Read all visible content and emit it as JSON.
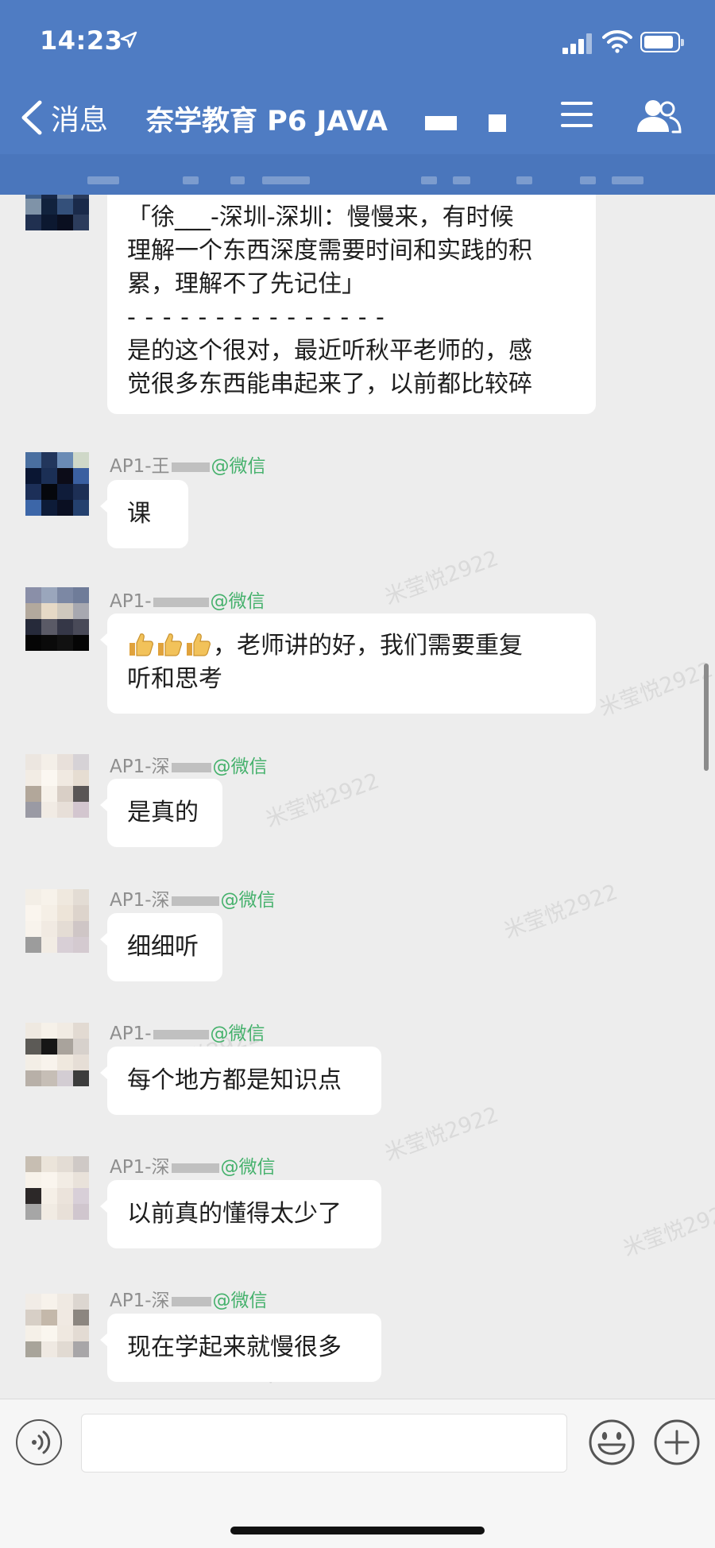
{
  "status_bar": {
    "time": "14:23",
    "icons": [
      "location-arrow-icon",
      "signal-icon",
      "wifi-icon",
      "battery-icon"
    ]
  },
  "nav": {
    "back_label": "消息",
    "title": "奈学教育 P6 JAVA",
    "icons": [
      "chevron-left-icon",
      "menu-icon",
      "people-icon"
    ]
  },
  "colors": {
    "header": "#4F7CC3",
    "chat_bg": "#EDEDED",
    "bubble": "#FFFFFF",
    "source_green": "#45B16C"
  },
  "watermark": "米莹悦2922",
  "messages": [
    {
      "lines": [
        "「徐___-深圳-深圳：慢慢来，有时候",
        "理解一个东西深度需要时间和实践的积",
        "累，理解不了先记住」",
        "- - - - - - - - - - - - - - -",
        "是的这个很对，最近听秋平老师的，感",
        "觉很多东西能串起来了，以前都比较碎"
      ]
    },
    {
      "sender_prefix": "AP1-王",
      "sender_suffix": "@微信",
      "lines": [
        "课"
      ]
    },
    {
      "sender_prefix": "AP1-",
      "sender_suffix": "@微信",
      "lines": [
        "，老师讲的好，我们需要重复",
        "听和思考"
      ],
      "emoji": "thumbs-up-icon"
    },
    {
      "sender_prefix": "AP1-深",
      "sender_suffix": "@微信",
      "lines": [
        "是真的"
      ]
    },
    {
      "sender_prefix": "AP1-深",
      "sender_suffix": "@微信",
      "lines": [
        "细细听"
      ]
    },
    {
      "sender_prefix": "AP1-",
      "sender_suffix": "@微信",
      "lines": [
        "每个地方都是知识点"
      ]
    },
    {
      "sender_prefix": "AP1-深",
      "sender_suffix": "@微信",
      "lines": [
        "以前真的懂得太少了"
      ]
    },
    {
      "sender_prefix": "AP1-深",
      "sender_suffix": "@微信",
      "lines": [
        "现在学起来就慢很多"
      ]
    }
  ],
  "input": {
    "value": "",
    "icons": [
      "voice-icon",
      "emoji-icon",
      "plus-icon"
    ]
  }
}
